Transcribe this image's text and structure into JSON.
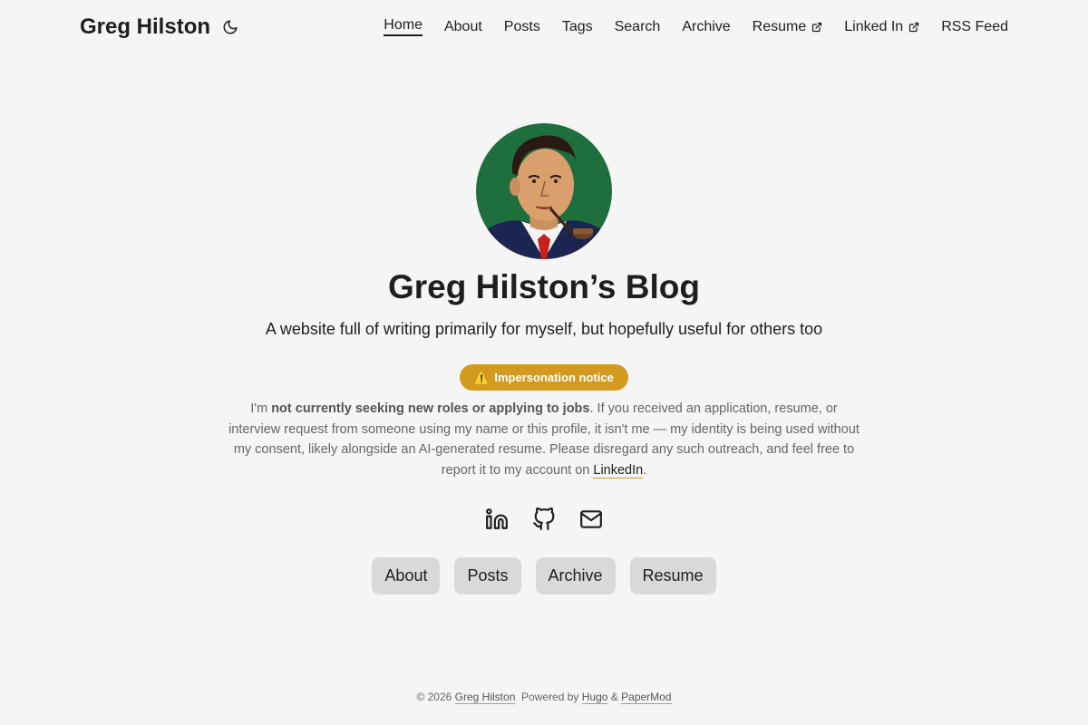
{
  "site": {
    "title": "Greg Hilston",
    "theme_icon": "moon-icon"
  },
  "nav": {
    "items": [
      {
        "label": "Home",
        "active": true
      },
      {
        "label": "About"
      },
      {
        "label": "Posts"
      },
      {
        "label": "Tags"
      },
      {
        "label": "Search"
      },
      {
        "label": "Archive"
      },
      {
        "label": "Resume",
        "external": true
      },
      {
        "label": "Linked In",
        "external": true
      },
      {
        "label": "RSS Feed"
      }
    ]
  },
  "hero": {
    "title": "Greg Hilston’s Blog",
    "subtitle": "A website full of writing primarily for myself, but hopefully useful for others too"
  },
  "notice": {
    "badge_icon": "⚠️",
    "badge_label": "Impersonation notice",
    "text_prefix": "I'm ",
    "text_bold": "not currently seeking new roles or applying to jobs",
    "text_body": ". If you received an application, resume, or interview request from someone using my name or this profile, it isn't me — my identity is being used without my consent, likely alongside an AI-generated resume. Please disregard any such outreach, and feel free to report it to my account on ",
    "link_label": "LinkedIn",
    "text_suffix": "."
  },
  "socials": [
    "linkedin-icon",
    "github-icon",
    "email-icon"
  ],
  "buttons": {
    "about": "About",
    "posts": "Posts",
    "archive": "Archive",
    "resume": "Resume"
  },
  "footer": {
    "copyright": "© 2026",
    "author": "Greg Hilston",
    "powered_by": "Powered by",
    "hugo": "Hugo",
    "amp": "&",
    "papermod": "PaperMod"
  },
  "colors": {
    "background": "#f5f5f5",
    "badge": "#d29a1e",
    "button": "#d9d9d9",
    "text": "#1e1e1e"
  }
}
